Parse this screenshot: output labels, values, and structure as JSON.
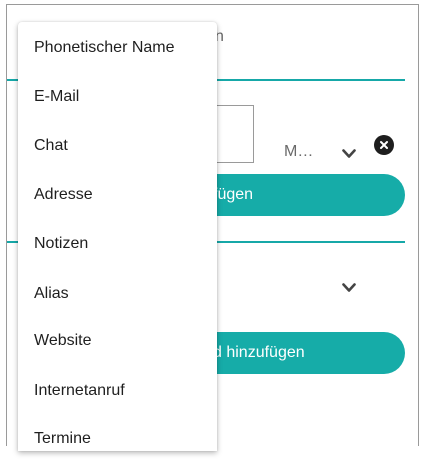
{
  "background": {
    "partial_name_suffix": "n",
    "type_label": "M…",
    "add_button_1_label": "fügen",
    "add_button_2_label": "d hinzufügen"
  },
  "menu": {
    "items": [
      "Phonetischer Name",
      "E-Mail",
      "Chat",
      "Adresse",
      "Notizen",
      "Alias",
      "Website",
      "Internetanruf",
      "Termine"
    ]
  },
  "colors": {
    "accent": "#16aca8",
    "text": "#1f1f1f",
    "clear_icon": "#1e1e1e"
  },
  "icons": {
    "dropdown": "chevron-down-icon",
    "clear": "close-icon"
  }
}
